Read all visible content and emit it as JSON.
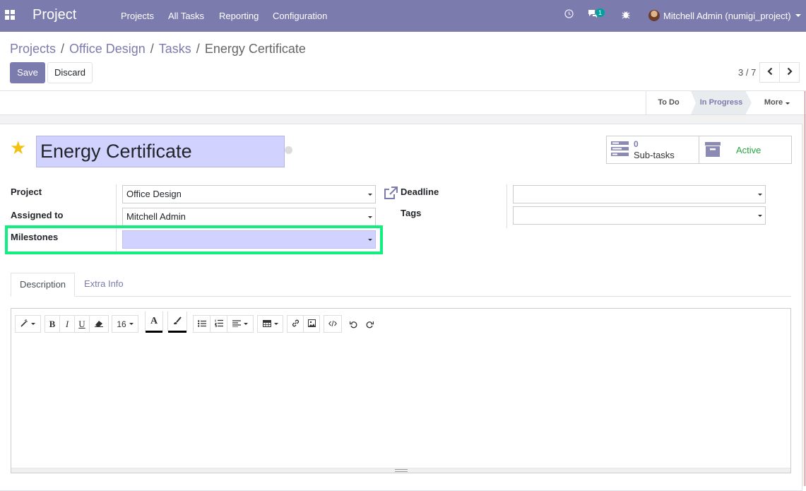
{
  "navbar": {
    "brand": "Project",
    "menu": [
      "Projects",
      "All Tasks",
      "Reporting",
      "Configuration"
    ],
    "chat_badge": "1",
    "user": "Mitchell Admin (numigi_project)",
    "icons": [
      "apps-icon",
      "clock-icon",
      "chat-icon",
      "bug-icon"
    ]
  },
  "breadcrumb": {
    "items": [
      "Projects",
      "Office Design",
      "Tasks"
    ],
    "current": "Energy Certificate",
    "separator": "/"
  },
  "buttons": {
    "save": "Save",
    "discard": "Discard"
  },
  "pager": {
    "value": "3 / 7"
  },
  "statusbar": {
    "stages": [
      "To Do",
      "In Progress"
    ],
    "current": "In Progress",
    "more": "More"
  },
  "title": {
    "value": "Energy Certificate"
  },
  "stat_buttons": {
    "subtasks": {
      "count": "0",
      "label": "Sub-tasks"
    },
    "active": {
      "label": "Active"
    }
  },
  "fields": {
    "project": {
      "label": "Project",
      "value": "Office Design"
    },
    "assigned_to": {
      "label": "Assigned to",
      "value": "Mitchell Admin"
    },
    "milestones": {
      "label": "Milestones",
      "value": ""
    },
    "deadline": {
      "label": "Deadline",
      "value": ""
    },
    "tags": {
      "label": "Tags",
      "value": ""
    }
  },
  "tabs": {
    "items": [
      "Description",
      "Extra Info"
    ],
    "active": "Description"
  },
  "editor": {
    "font_size": "16",
    "font_color_glyph": "A"
  },
  "colors": {
    "primary": "#7c7bad",
    "highlight": "#12ee7f",
    "title_bg": "#d2d2ff",
    "star": "#f3c211",
    "active_green": "#28a745"
  }
}
